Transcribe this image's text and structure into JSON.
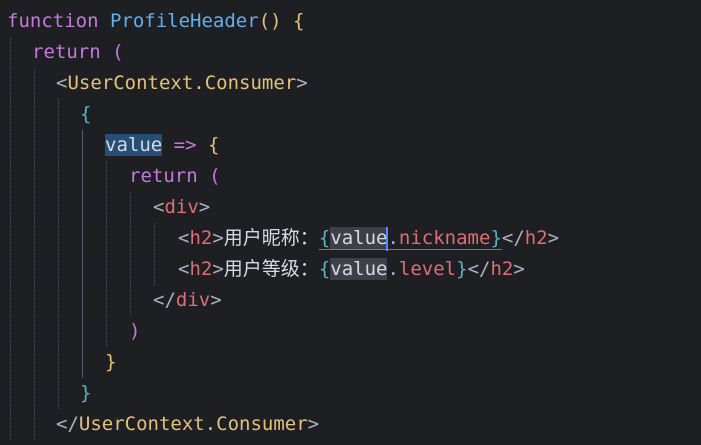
{
  "editor": {
    "lines": [
      {
        "t": "function"
      },
      {
        "t": "ProfileHeader"
      },
      {
        "t": "return"
      },
      {
        "t": "UserContext.Consumer"
      },
      {
        "t": "value"
      },
      {
        "t": "return"
      },
      {
        "t": "div"
      },
      {
        "t": "h2",
        "label": "用户昵称：",
        "expr_obj": "value",
        "expr_prop": "nickname"
      },
      {
        "t": "h2",
        "label": "用户等级：",
        "expr_obj": "value",
        "expr_prop": "level"
      },
      {
        "t": "div"
      },
      {
        "t": "close"
      }
    ],
    "kw_function": "function",
    "fn_name": "ProfileHeader",
    "kw_return": "return",
    "component": "UserContext.Consumer",
    "param": "value",
    "tag_div": "div",
    "tag_h2": "h2",
    "label_nickname": "用户昵称：",
    "label_level": "用户等级：",
    "obj": "value",
    "prop_nickname": "nickname",
    "prop_level": "level"
  },
  "colors": {
    "background": "#1e1f22",
    "keyword": "#c678dd",
    "function": "#61afef",
    "component": "#e5c07b",
    "tag": "#e06c75",
    "selection": "#264f78"
  }
}
